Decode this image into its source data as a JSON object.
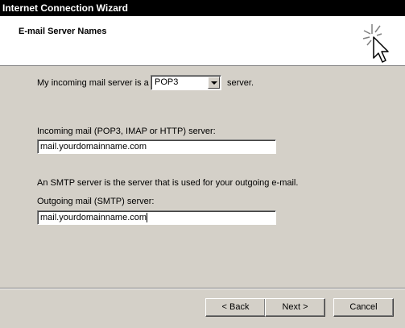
{
  "window": {
    "title": "Internet Connection Wizard"
  },
  "header": {
    "title": "E-mail Server Names",
    "icon": "wizard-cursor-icon"
  },
  "incoming_type": {
    "prefix": "My incoming mail server is a",
    "selected": "POP3",
    "suffix": "server."
  },
  "incoming_server": {
    "label": "Incoming mail (POP3, IMAP or HTTP) server:",
    "value": "mail.yourdomainname.com"
  },
  "smtp_note": "An SMTP server is the server that is used for your outgoing e-mail.",
  "outgoing_server": {
    "label": "Outgoing mail (SMTP) server:",
    "value": "mail.yourdomainname.com"
  },
  "buttons": {
    "back": "< Back",
    "next": "Next >",
    "cancel": "Cancel"
  }
}
